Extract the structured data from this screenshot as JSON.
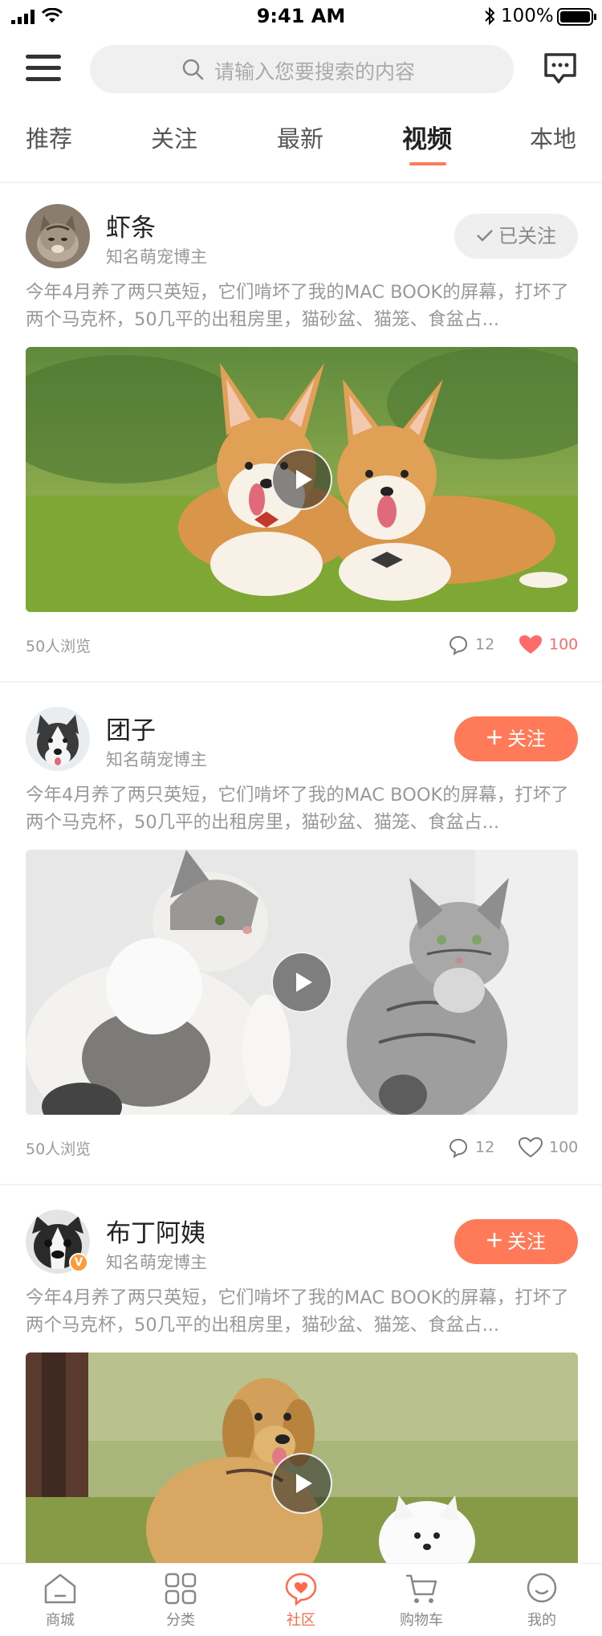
{
  "status_bar": {
    "time": "9:41 AM",
    "battery": "100%"
  },
  "search": {
    "placeholder": "请输入您要搜索的内容"
  },
  "tabs": [
    {
      "label": "推荐"
    },
    {
      "label": "关注"
    },
    {
      "label": "最新"
    },
    {
      "label": "视频",
      "active": true
    },
    {
      "label": "本地"
    }
  ],
  "posts": [
    {
      "author": "虾条",
      "title": "知名萌宠博主",
      "follow_label": "已关注",
      "followed": true,
      "text": "今年4月养了两只英短，它们啃坏了我的MAC BOOK的屏幕，打坏了两个马克杯，50几平的出租房里，猫砂盆、猫笼、食盆占...",
      "views": "50人浏览",
      "comments": "12",
      "likes": "100",
      "liked": true,
      "video_subject": "corgi"
    },
    {
      "author": "团子",
      "title": "知名萌宠博主",
      "follow_label": "关注",
      "followed": false,
      "text": "今年4月养了两只英短，它们啃坏了我的MAC BOOK的屏幕，打坏了两个马克杯，50几平的出租房里，猫砂盆、猫笼、食盆占...",
      "views": "50人浏览",
      "comments": "12",
      "likes": "100",
      "liked": false,
      "video_subject": "cats"
    },
    {
      "author": "布丁阿姨",
      "title": "知名萌宠博主",
      "follow_label": "关注",
      "followed": false,
      "verified": "V",
      "text": "今年4月养了两只英短，它们啃坏了我的MAC BOOK的屏幕，打坏了两个马克杯，50几平的出租房里，猫砂盆、猫笼、食盆占...",
      "video_subject": "golden-retriever"
    }
  ],
  "tabbar": [
    {
      "label": "商城",
      "icon": "home-icon"
    },
    {
      "label": "分类",
      "icon": "grid-icon"
    },
    {
      "label": "社区",
      "icon": "community-icon",
      "active": true
    },
    {
      "label": "购物车",
      "icon": "cart-icon"
    },
    {
      "label": "我的",
      "icon": "profile-icon"
    }
  ],
  "colors": {
    "accent": "#ff7a59",
    "like": "#ff6b6b"
  }
}
